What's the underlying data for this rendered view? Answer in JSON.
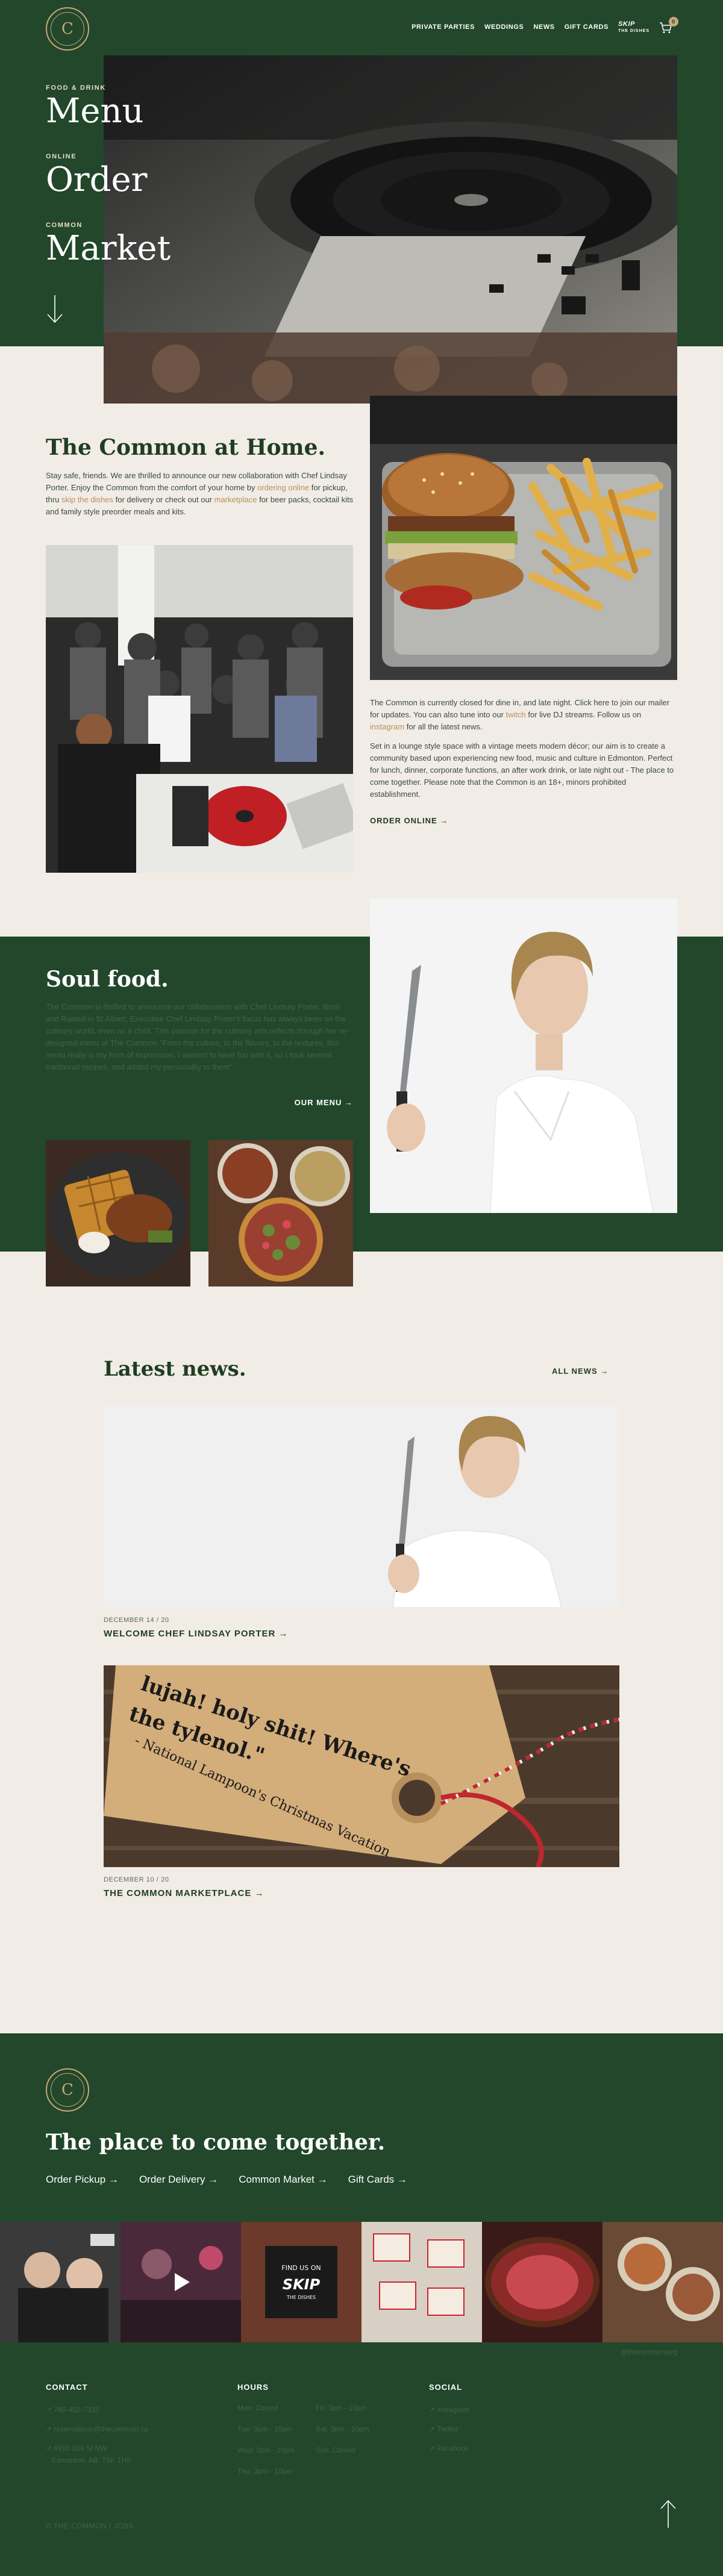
{
  "nav": {
    "items": [
      "PRIVATE PARTIES",
      "WEDDINGS",
      "NEWS",
      "GIFT CARDS"
    ],
    "skip_logo": "SKIP",
    "skip_logo_sub": "THE DISHES",
    "cart_count": "0"
  },
  "logo": {
    "glyph": "C"
  },
  "hero": {
    "items": [
      {
        "eyebrow": "FOOD & DRINK",
        "title": "Menu"
      },
      {
        "eyebrow": "ONLINE",
        "title": "Order"
      },
      {
        "eyebrow": "COMMON",
        "title": "Market"
      }
    ]
  },
  "home": {
    "title": "The Common at Home.",
    "intro_1": "Stay safe, friends.  We are thrilled to announce our new collaboration with Chef Lindsay Porter.  Enjoy the Common from the comfort of your home by ",
    "intro_link1": "ordering online",
    "intro_2": " for pickup, thru ",
    "intro_link2": "skip the dishes",
    "intro_3": " for delivery or check out our ",
    "intro_link3": "marketplace",
    "intro_4": " for beer packs, cocktail kits and family style preorder meals and kits.",
    "p1_a": "The Common is currently closed for dine in, and late night. Click here to join our mailer for updates. You can also tune into our ",
    "p1_link1": "twitch",
    "p1_b": " for live DJ streams. Follow us on ",
    "p1_link2": "instagram",
    "p1_c": " for all the latest news.",
    "p2": "Set in a lounge style space with a vintage meets modern décor; our aim is to create a community based upon experiencing new food, music and culture in Edmonton. Perfect for lunch, dinner, corporate functions, an after work drink, or late night out - The place to come together. Please note that the Common is an 18+, minors prohibited establishment.",
    "order_online": "ORDER ONLINE"
  },
  "soul": {
    "title": "Soul food.",
    "text": "The Common is thrilled to announce our collaboration with Chef Lindsay Porter. Born and Raised in St Albert, Executive Chef Lindsay Porter's focus has always been on the culinary world, even as a child. This passion for the culinary arts reflects through her re-designed menu at The Common \"From the culture, to the flavors, to the textures, this menu really is my form of expression. I wanted to have fun with it, so I took several traditional recipes, and added my personality to them\".",
    "our_menu": "OUR MENU"
  },
  "news": {
    "title": "Latest news.",
    "all_news": "ALL NEWS",
    "posts": [
      {
        "date": "DECEMBER 14 / 20",
        "title": "WELCOME CHEF LINDSAY PORTER"
      },
      {
        "date": "DECEMBER 10 / 20",
        "title": "THE COMMON MARKETPLACE"
      }
    ],
    "tag_line1": "lujah! holy shit! Where's",
    "tag_line2": "the tylenol.\"",
    "tag_line3": "- National Lampoon's Christmas Vacation"
  },
  "footer": {
    "title": "The place to come together.",
    "links": [
      "Order Pickup",
      "Order Delivery",
      "Common Market",
      "Gift Cards"
    ],
    "insta_handle": "@thecommonyeg",
    "contact_title": "CONTACT",
    "contact": [
      "780-452-7333",
      "reservations@thecommon.ca",
      "9910 109 St NW",
      "Edmonton, AB, T5K 1H5"
    ],
    "hours_title": "HOURS",
    "hours": [
      [
        "Mon: Closed",
        "Fri: 3pm - 10pm"
      ],
      [
        "Tue: 3pm - 10pm",
        "Sat: 3pm - 10pm"
      ],
      [
        "Wed: 3pm - 10pm",
        "Sun: Closed"
      ],
      [
        "Thu: 3pm - 10pm",
        ""
      ]
    ],
    "social_title": "SOCIAL",
    "social": [
      "Instagram",
      "Twitter",
      "Facebook"
    ],
    "copyright": "© THE COMMON | JOBS",
    "skip_text1": "FIND US ON",
    "skip_text2": "SKIP",
    "skip_text3": "THE DISHES"
  },
  "colors": {
    "green": "#22472a",
    "cream": "#f1ece6",
    "gold": "#c9a87a"
  }
}
